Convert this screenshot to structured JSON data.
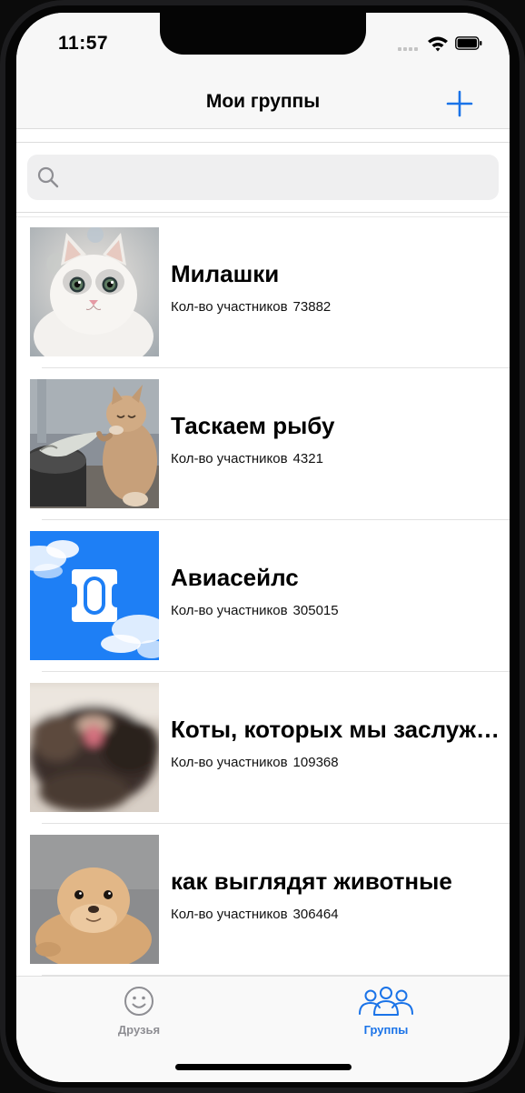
{
  "status_bar": {
    "time": "11:57"
  },
  "nav": {
    "title": "Мои группы",
    "add_icon": "plus-icon"
  },
  "search": {
    "placeholder": "",
    "value": ""
  },
  "groups": [
    {
      "name": "Милашки",
      "members_label": "Кол-во участников",
      "members_count": "73882",
      "image": "white-kitten-photo"
    },
    {
      "name": "Таскаем рыбу",
      "members_label": "Кол-во участников",
      "members_count": "4321",
      "image": "cat-with-fish-photo"
    },
    {
      "name": "Авиасейлс",
      "members_label": "Кол-во участников",
      "members_count": "305015",
      "image": "aviasales-logo"
    },
    {
      "name": "Коты, которых мы заслужили",
      "members_label": "Кол-во участников",
      "members_count": "109368",
      "image": "blurry-cat-photo"
    },
    {
      "name": "как выглядят животные",
      "members_label": "Кол-во участников",
      "members_count": "306464",
      "image": "seal-pup-photo"
    }
  ],
  "tabs": [
    {
      "label": "Друзья",
      "icon": "smiley-icon",
      "selected": false
    },
    {
      "label": "Группы",
      "icon": "people-group-icon",
      "selected": true
    }
  ],
  "colors": {
    "accent": "#1a73e8",
    "inactive": "#8e8e93",
    "aviasales_blue": "#1e7ff5"
  }
}
